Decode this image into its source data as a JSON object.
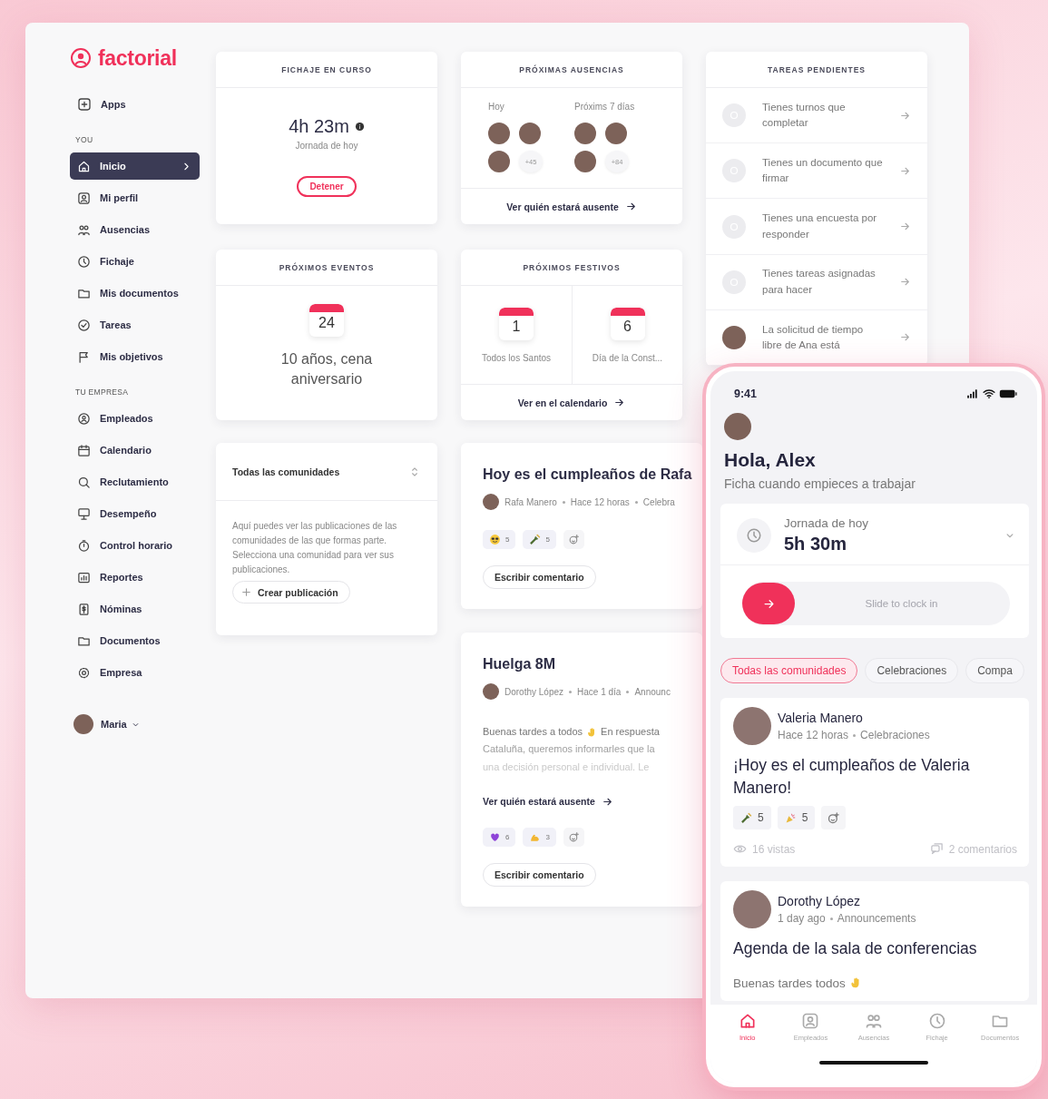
{
  "logo": {
    "text": "factorial"
  },
  "sidebar": {
    "apps": {
      "label": "Apps"
    },
    "sections": [
      {
        "title": "YOU",
        "items": [
          {
            "label": "Inicio",
            "selected": true
          },
          {
            "label": "Mi perfil",
            "selected": false
          },
          {
            "label": "Ausencias",
            "selected": false
          },
          {
            "label": "Fichaje",
            "selected": false
          },
          {
            "label": "Mis documentos",
            "selected": false
          },
          {
            "label": "Tareas",
            "selected": false
          },
          {
            "label": "Mis objetivos",
            "selected": false
          }
        ]
      },
      {
        "title": "TU EMPRESA",
        "items": [
          {
            "label": "Empleados",
            "selected": false
          },
          {
            "label": "Calendario",
            "selected": false
          },
          {
            "label": "Reclutamiento",
            "selected": false
          },
          {
            "label": "Desempeño",
            "selected": false
          },
          {
            "label": "Control horario",
            "selected": false
          },
          {
            "label": "Reportes",
            "selected": false
          },
          {
            "label": "Nóminas",
            "selected": false
          },
          {
            "label": "Documentos",
            "selected": false
          },
          {
            "label": "Empresa",
            "selected": false
          }
        ]
      }
    ],
    "user": {
      "name": "Maria"
    }
  },
  "clock_card": {
    "title": "FICHAJE EN CURSO",
    "time": "4h 23m",
    "caption": "Jornada de hoy",
    "button": "Detener"
  },
  "absences_card": {
    "title": "PRÓXIMAS AUSENCIAS",
    "groups": [
      {
        "label": "Hoy",
        "more": "+45"
      },
      {
        "label": "Próxims 7 días",
        "more": "+84"
      }
    ],
    "link": "Ver quién estará ausente"
  },
  "tasks_card": {
    "title": "TAREAS PENDIENTES",
    "tasks": [
      {
        "kind": "icon",
        "text": "Tienes turnos que completar"
      },
      {
        "kind": "icon",
        "text": "Tienes un documento que firmar"
      },
      {
        "kind": "icon",
        "text": "Tienes una encuesta por responder"
      },
      {
        "kind": "icon",
        "text": "Tienes tareas asignadas para hacer"
      },
      {
        "kind": "avatar",
        "text": "La solicitud de tiempo libre de Ana está"
      }
    ]
  },
  "events_card": {
    "title": "PRÓXIMOS EVENTOS",
    "events": [
      {
        "day": "24",
        "name": "10 años, cena aniversario"
      }
    ]
  },
  "holidays_card": {
    "title": "PRÓXIMOS FESTIVOS",
    "holidays": [
      {
        "day": "1",
        "name": "Todos los Santos"
      },
      {
        "day": "6",
        "name": "Día de la Const..."
      }
    ],
    "link": "Ver en el calendario"
  },
  "communities_card": {
    "select": "Todas las comunidades",
    "description": "Aquí puedes ver las publicaciones de las comunidades de las que formas parte. Selecciona una comunidad para ver sus publicaciones.",
    "button": "Crear publicación"
  },
  "posts": [
    {
      "title": "Hoy es el cumpleaños de Rafa",
      "author": "Rafa Manero",
      "time": "Hace 12 horas",
      "channel": "Celebra",
      "reactions": [
        {
          "kind": "sunglasses",
          "count": "5"
        },
        {
          "kind": "bottle",
          "count": "5"
        }
      ],
      "comment_button": "Escribir comentario"
    },
    {
      "title": "Huelga 8M",
      "author": "Dorothy López",
      "time": "Hace 1 día",
      "channel": "Announc",
      "body": [
        [
          "Buenas tardes a todos",
          "En respuesta"
        ],
        [
          "Cataluña, queremos informarles que la"
        ],
        [
          "una decisión personal e individual. Le"
        ]
      ],
      "link": "Ver quién estará ausente",
      "reactions": [
        {
          "kind": "heart",
          "count": "6"
        },
        {
          "kind": "muscle",
          "count": "3"
        }
      ],
      "comment_button": "Escribir comentario"
    }
  ],
  "phone": {
    "status_time": "9:41",
    "greeting": "Hola, Alex",
    "subtitle": "Ficha cuando empieces a trabajar",
    "shift": {
      "label": "Jornada de hoy",
      "time": "5h 30m",
      "slider": "Slide to clock in",
      "level": 0
    },
    "chips": [
      {
        "label": "Todas las comunidades",
        "selected": true
      },
      {
        "label": "Celebraciones",
        "selected": false
      },
      {
        "label": "Compa",
        "selected": false
      }
    ],
    "posts": [
      {
        "author": "Valeria Manero",
        "time": "Hace 12 horas",
        "channel": "Celebraciones",
        "title": "¡Hoy es el cumpleaños de Valeria Manero!",
        "reactions": [
          {
            "kind": "bottle",
            "count": "5"
          },
          {
            "kind": "confetti",
            "count": "5"
          }
        ],
        "views": "16 vistas",
        "comments": "2 comentarios"
      },
      {
        "author": "Dorothy López",
        "time": "1 day ago",
        "channel": "Announcements",
        "title": "Agenda de la sala de conferencias",
        "body": "Buenas tardes todos"
      }
    ],
    "nav": [
      {
        "label": "Inicio",
        "selected": true
      },
      {
        "label": "Empleados",
        "selected": false
      },
      {
        "label": "Ausencias",
        "selected": false
      },
      {
        "label": "Fichaje",
        "selected": false
      },
      {
        "label": "Documentos",
        "selected": false
      }
    ]
  }
}
